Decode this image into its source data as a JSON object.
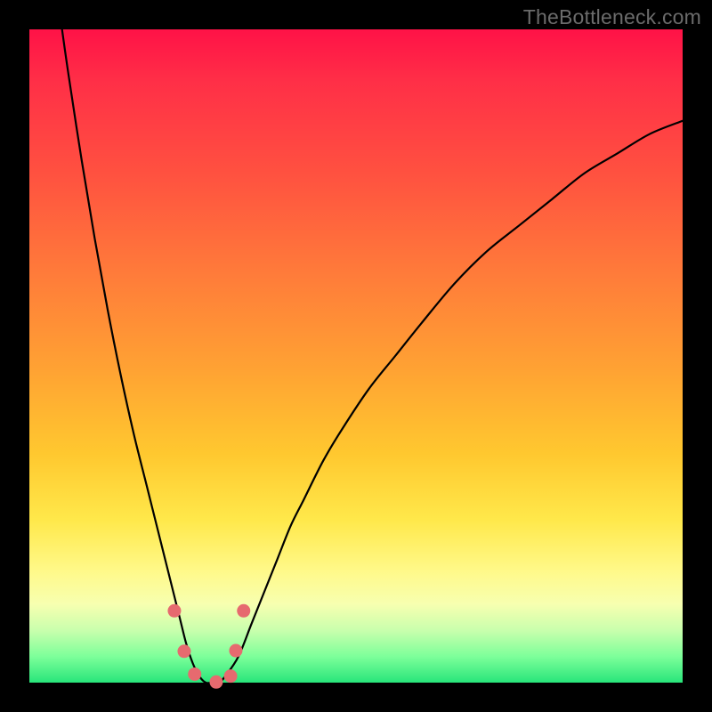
{
  "watermark": "TheBottleneck.com",
  "chart_data": {
    "type": "line",
    "title": "",
    "xlabel": "",
    "ylabel": "",
    "xlim": [
      0,
      100
    ],
    "ylim": [
      0,
      100
    ],
    "grid": false,
    "series": [
      {
        "name": "curve",
        "x": [
          5,
          6,
          8,
          10,
          12,
          14,
          16,
          18,
          20,
          21,
          22,
          23,
          24,
          25,
          26,
          27,
          28,
          29,
          30,
          32,
          34,
          36,
          38,
          40,
          42,
          45,
          48,
          52,
          56,
          60,
          65,
          70,
          75,
          80,
          85,
          90,
          95,
          100
        ],
        "y": [
          100,
          93,
          80,
          68,
          57,
          47,
          38,
          30,
          22,
          18,
          14,
          10,
          6,
          3,
          1,
          0,
          0,
          0,
          1,
          4,
          9,
          14,
          19,
          24,
          28,
          34,
          39,
          45,
          50,
          55,
          61,
          66,
          70,
          74,
          78,
          81,
          84,
          86
        ]
      }
    ],
    "markers": {
      "name": "highlight-dots",
      "color": "#e66a6f",
      "points": [
        {
          "x": 22.2,
          "y": 11.0
        },
        {
          "x": 23.7,
          "y": 4.8
        },
        {
          "x": 25.3,
          "y": 1.3
        },
        {
          "x": 28.6,
          "y": 0.1
        },
        {
          "x": 30.8,
          "y": 1.0
        },
        {
          "x": 31.6,
          "y": 4.9
        },
        {
          "x": 32.8,
          "y": 11.0
        }
      ]
    }
  }
}
